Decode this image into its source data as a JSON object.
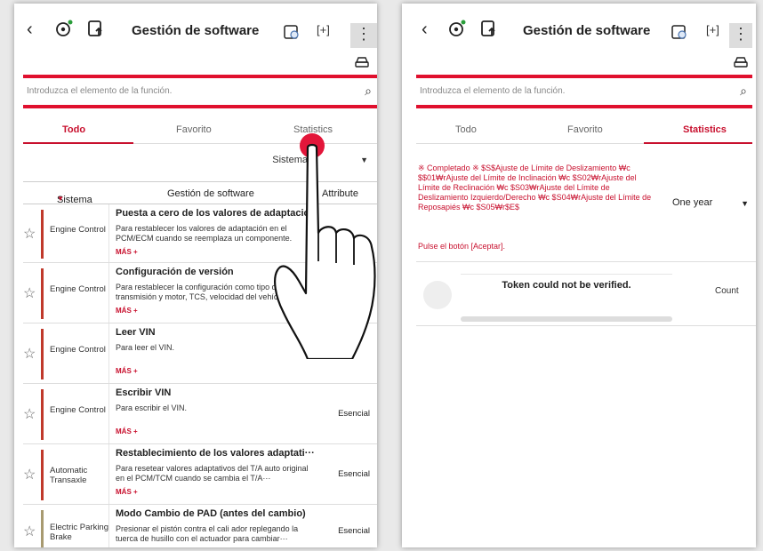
{
  "left": {
    "header": {
      "title": "Gestión de software"
    },
    "search": {
      "placeholder": "Introduzca el elemento de la función."
    },
    "tabs": [
      "Todo",
      "Favorito",
      "Statistics"
    ],
    "filter": "Sistema",
    "columns": {
      "system": "Sistema",
      "software": "Gestión de software",
      "attribute": "Attribute"
    },
    "rows": [
      {
        "system": "Engine Control",
        "name": "Puesta a cero de los valores de adaptación",
        "desc": "Para restablecer los valores de adaptación en el PCM/ECM cuando se reemplaza un componente.",
        "more": "MÁS +",
        "attr": "",
        "bar": "#c0392b"
      },
      {
        "system": "Engine Control",
        "name": "Configuración de versión",
        "desc": "Para restablecer la configuración como tipo de transmisión y motor, TCS, velocidad del vehículo.",
        "more": "MÁS +",
        "attr": "",
        "bar": "#c0392b"
      },
      {
        "system": "Engine Control",
        "name": "Leer VIN",
        "desc": "Para leer el VIN.",
        "more": "MÁS +",
        "attr": "",
        "bar": "#c0392b"
      },
      {
        "system": "Engine Control",
        "name": "Escribir VIN",
        "desc": "Para escribir el VIN.",
        "more": "MÁS +",
        "attr": "Esencial",
        "bar": "#c0392b"
      },
      {
        "system": "Automatic Transaxle",
        "name": "Restablecimiento de los valores adaptati···",
        "desc": "Para resetear valores adaptativos del T/A auto original en el PCM/TCM cuando se cambia el T/A···",
        "more": "MÁS +",
        "attr": "Esencial",
        "bar": "#c0392b"
      },
      {
        "system": "Electric Parking Brake",
        "name": "Modo Cambio de PAD (antes del cambio)",
        "desc": "Presionar el pistón contra el cali ador replegando la tuerca de husillo con el actuador para cambiar···",
        "more": "",
        "attr": "Esencial",
        "bar": "#a89a70"
      }
    ]
  },
  "right": {
    "header": {
      "title": "Gestión de software"
    },
    "search": {
      "placeholder": "Introduzca el elemento de la función."
    },
    "tabs": [
      "Todo",
      "Favorito",
      "Statistics"
    ],
    "completed_text": "※ Completado ※ $S$Ajuste de Límite de Deslizamiento ₩c $$01₩rAjuste del Límite de Inclinación ₩c $S02₩rAjuste del Límite de Reclinación ₩c $S03₩rAjuste del Límite de Deslizamiento Izquierdo/Derecho ₩c $S04₩rAjuste del Límite de Reposapiés ₩c $S05₩r$E$",
    "period": "One year",
    "press_text": "Pulse el botón [Aceptar].",
    "token_msg": "Token could not be verified.",
    "count_label": "Count"
  },
  "colors": {
    "accent": "#c8102e",
    "redbar": "#e0102e"
  }
}
